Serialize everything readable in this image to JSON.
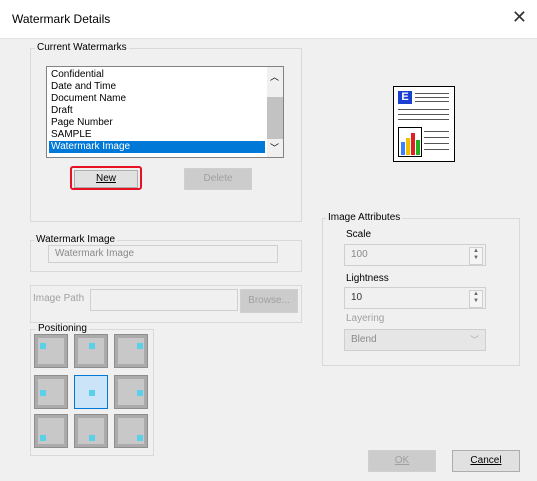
{
  "window": {
    "title": "Watermark Details",
    "close_icon": "close-icon"
  },
  "current_watermarks": {
    "label": "Current Watermarks",
    "items": [
      "Confidential",
      "Date and Time",
      "Document Name",
      "Draft",
      "Page Number",
      "SAMPLE",
      "Watermark Image"
    ],
    "selected_index": 6,
    "new_label": "New",
    "delete_label": "Delete"
  },
  "watermark_image": {
    "label": "Watermark Image",
    "value": "Watermark Image"
  },
  "image_path": {
    "label": "Image Path",
    "value": "",
    "browse_label": "Browse..."
  },
  "positioning": {
    "label": "Positioning",
    "selected_cell": 4
  },
  "image_attributes": {
    "label": "Image Attributes",
    "scale_label": "Scale",
    "scale_value": "100",
    "lightness_label": "Lightness",
    "lightness_value": "10",
    "layering_label": "Layering",
    "layering_value": "Blend"
  },
  "footer": {
    "ok_label": "OK",
    "cancel_label": "Cancel"
  },
  "colors": {
    "accent": "#0078d7",
    "highlight_border": "#e81123",
    "cell_dot": "#5ad0ea"
  }
}
